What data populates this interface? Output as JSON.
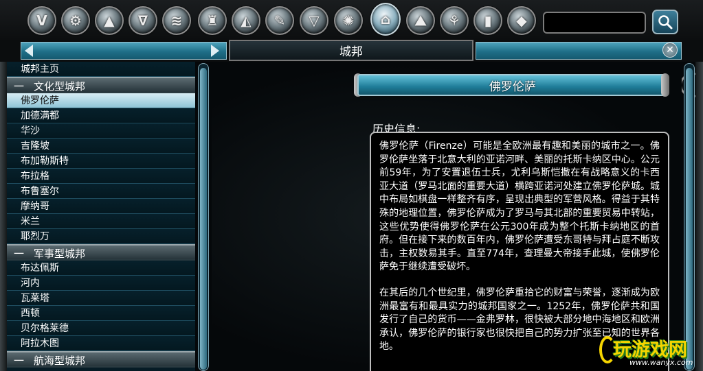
{
  "toolbar": {
    "category_icons": [
      {
        "name": "civilization-icon",
        "glyph": "V"
      },
      {
        "name": "technology-icon",
        "glyph": "⚙"
      },
      {
        "name": "units-icon",
        "glyph": "▲"
      },
      {
        "name": "promotions-icon",
        "glyph": "∇"
      },
      {
        "name": "buildings-icon",
        "glyph": "≋"
      },
      {
        "name": "wonders-icon",
        "glyph": "♜"
      },
      {
        "name": "great-people-icon",
        "glyph": "◭"
      },
      {
        "name": "policies-icon",
        "glyph": "✎"
      },
      {
        "name": "religion-icon",
        "glyph": "▽"
      },
      {
        "name": "congress-icon",
        "glyph": "✺"
      },
      {
        "name": "city-states-icon",
        "glyph": "⌂"
      },
      {
        "name": "terrain-icon",
        "glyph": "⛰"
      },
      {
        "name": "resources-icon",
        "glyph": "⚘"
      },
      {
        "name": "improvements-icon",
        "glyph": "▮"
      },
      {
        "name": "concepts-icon",
        "glyph": "◆"
      }
    ],
    "active_index": 10,
    "search": {
      "value": "",
      "placeholder": ""
    }
  },
  "title_bar": {
    "title": "城邦"
  },
  "sidebar": {
    "entries": [
      {
        "type": "item",
        "label": "城邦主页"
      },
      {
        "type": "header",
        "dash": "一",
        "label": "文化型城邦"
      },
      {
        "type": "item",
        "label": "佛罗伦萨",
        "selected": true
      },
      {
        "type": "item",
        "label": "加德满都"
      },
      {
        "type": "item",
        "label": "华沙"
      },
      {
        "type": "item",
        "label": "吉隆坡"
      },
      {
        "type": "item",
        "label": "布加勒斯特"
      },
      {
        "type": "item",
        "label": "布拉格"
      },
      {
        "type": "item",
        "label": "布鲁塞尔"
      },
      {
        "type": "item",
        "label": "摩纳哥"
      },
      {
        "type": "item",
        "label": "米兰"
      },
      {
        "type": "item",
        "label": "耶烈万"
      },
      {
        "type": "header",
        "dash": "一",
        "label": "军事型城邦"
      },
      {
        "type": "item",
        "label": "布达佩斯"
      },
      {
        "type": "item",
        "label": "河内"
      },
      {
        "type": "item",
        "label": "瓦莱塔"
      },
      {
        "type": "item",
        "label": "西顿"
      },
      {
        "type": "item",
        "label": "贝尔格莱德"
      },
      {
        "type": "item",
        "label": "阿拉木图"
      },
      {
        "type": "header",
        "dash": "一",
        "label": "航海型城邦"
      }
    ]
  },
  "article": {
    "city_name": "佛罗伦萨",
    "history_label": "历史信息:",
    "paragraphs": [
      "佛罗伦萨（Firenze）可能是全欧洲最有趣和美丽的城市之一。佛罗伦萨坐落于北意大利的亚诺河畔、美丽的托斯卡纳区中心。公元前59年，为了安置退伍士兵，尤利乌斯恺撒在有战略意义的卡西亚大道（罗马北面的重要大道）横跨亚诺河处建立佛罗伦萨城。城中布局如棋盘一样整齐有序，呈现出典型的军营风格。得益于其特殊的地理位置，佛罗伦萨成为了罗马与其北部的重要贸易中转站，这些优势使得佛罗伦萨在公元300年成为整个托斯卡纳地区的首府。但在接下来的数百年内，佛罗伦萨遭受东哥特与拜占庭不断攻击，主权数易其手。直至774年，查理曼大帝接手此城，使佛罗伦萨免于继续遭受破坏。",
      "在其后的几个世纪里，佛罗伦萨重拾它的财富与荣誉，逐渐成为欧洲最富有和最具实力的城邦国家之一。1252年，佛罗伦萨共和国发行了自己的货币——金弗罗林，很快被大部分地中海地区和欧洲承认，佛罗伦萨的银行家也很快把自己的势力扩张至已知的世界各地。"
    ]
  },
  "watermark": {
    "main": "玩游戏网",
    "url": "www.wanyx.com"
  },
  "colors": {
    "accent": "#1f7c98",
    "selected_row": "#d7edf4",
    "watermark_yellow": "#f5d400"
  }
}
